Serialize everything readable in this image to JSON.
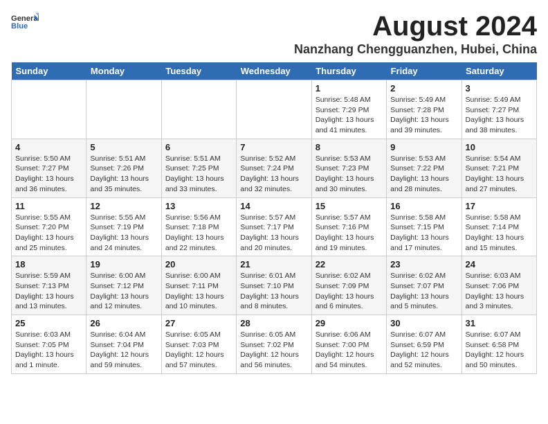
{
  "header": {
    "logo_general": "General",
    "logo_blue": "Blue",
    "title_month": "August 2024",
    "title_location": "Nanzhang Chengguanzhen, Hubei, China"
  },
  "days_of_week": [
    "Sunday",
    "Monday",
    "Tuesday",
    "Wednesday",
    "Thursday",
    "Friday",
    "Saturday"
  ],
  "weeks": [
    [
      {
        "day": "",
        "info": ""
      },
      {
        "day": "",
        "info": ""
      },
      {
        "day": "",
        "info": ""
      },
      {
        "day": "",
        "info": ""
      },
      {
        "day": "1",
        "info": "Sunrise: 5:48 AM\nSunset: 7:29 PM\nDaylight: 13 hours\nand 41 minutes."
      },
      {
        "day": "2",
        "info": "Sunrise: 5:49 AM\nSunset: 7:28 PM\nDaylight: 13 hours\nand 39 minutes."
      },
      {
        "day": "3",
        "info": "Sunrise: 5:49 AM\nSunset: 7:27 PM\nDaylight: 13 hours\nand 38 minutes."
      }
    ],
    [
      {
        "day": "4",
        "info": "Sunrise: 5:50 AM\nSunset: 7:27 PM\nDaylight: 13 hours\nand 36 minutes."
      },
      {
        "day": "5",
        "info": "Sunrise: 5:51 AM\nSunset: 7:26 PM\nDaylight: 13 hours\nand 35 minutes."
      },
      {
        "day": "6",
        "info": "Sunrise: 5:51 AM\nSunset: 7:25 PM\nDaylight: 13 hours\nand 33 minutes."
      },
      {
        "day": "7",
        "info": "Sunrise: 5:52 AM\nSunset: 7:24 PM\nDaylight: 13 hours\nand 32 minutes."
      },
      {
        "day": "8",
        "info": "Sunrise: 5:53 AM\nSunset: 7:23 PM\nDaylight: 13 hours\nand 30 minutes."
      },
      {
        "day": "9",
        "info": "Sunrise: 5:53 AM\nSunset: 7:22 PM\nDaylight: 13 hours\nand 28 minutes."
      },
      {
        "day": "10",
        "info": "Sunrise: 5:54 AM\nSunset: 7:21 PM\nDaylight: 13 hours\nand 27 minutes."
      }
    ],
    [
      {
        "day": "11",
        "info": "Sunrise: 5:55 AM\nSunset: 7:20 PM\nDaylight: 13 hours\nand 25 minutes."
      },
      {
        "day": "12",
        "info": "Sunrise: 5:55 AM\nSunset: 7:19 PM\nDaylight: 13 hours\nand 24 minutes."
      },
      {
        "day": "13",
        "info": "Sunrise: 5:56 AM\nSunset: 7:18 PM\nDaylight: 13 hours\nand 22 minutes."
      },
      {
        "day": "14",
        "info": "Sunrise: 5:57 AM\nSunset: 7:17 PM\nDaylight: 13 hours\nand 20 minutes."
      },
      {
        "day": "15",
        "info": "Sunrise: 5:57 AM\nSunset: 7:16 PM\nDaylight: 13 hours\nand 19 minutes."
      },
      {
        "day": "16",
        "info": "Sunrise: 5:58 AM\nSunset: 7:15 PM\nDaylight: 13 hours\nand 17 minutes."
      },
      {
        "day": "17",
        "info": "Sunrise: 5:58 AM\nSunset: 7:14 PM\nDaylight: 13 hours\nand 15 minutes."
      }
    ],
    [
      {
        "day": "18",
        "info": "Sunrise: 5:59 AM\nSunset: 7:13 PM\nDaylight: 13 hours\nand 13 minutes."
      },
      {
        "day": "19",
        "info": "Sunrise: 6:00 AM\nSunset: 7:12 PM\nDaylight: 13 hours\nand 12 minutes."
      },
      {
        "day": "20",
        "info": "Sunrise: 6:00 AM\nSunset: 7:11 PM\nDaylight: 13 hours\nand 10 minutes."
      },
      {
        "day": "21",
        "info": "Sunrise: 6:01 AM\nSunset: 7:10 PM\nDaylight: 13 hours\nand 8 minutes."
      },
      {
        "day": "22",
        "info": "Sunrise: 6:02 AM\nSunset: 7:09 PM\nDaylight: 13 hours\nand 6 minutes."
      },
      {
        "day": "23",
        "info": "Sunrise: 6:02 AM\nSunset: 7:07 PM\nDaylight: 13 hours\nand 5 minutes."
      },
      {
        "day": "24",
        "info": "Sunrise: 6:03 AM\nSunset: 7:06 PM\nDaylight: 13 hours\nand 3 minutes."
      }
    ],
    [
      {
        "day": "25",
        "info": "Sunrise: 6:03 AM\nSunset: 7:05 PM\nDaylight: 13 hours\nand 1 minute."
      },
      {
        "day": "26",
        "info": "Sunrise: 6:04 AM\nSunset: 7:04 PM\nDaylight: 12 hours\nand 59 minutes."
      },
      {
        "day": "27",
        "info": "Sunrise: 6:05 AM\nSunset: 7:03 PM\nDaylight: 12 hours\nand 57 minutes."
      },
      {
        "day": "28",
        "info": "Sunrise: 6:05 AM\nSunset: 7:02 PM\nDaylight: 12 hours\nand 56 minutes."
      },
      {
        "day": "29",
        "info": "Sunrise: 6:06 AM\nSunset: 7:00 PM\nDaylight: 12 hours\nand 54 minutes."
      },
      {
        "day": "30",
        "info": "Sunrise: 6:07 AM\nSunset: 6:59 PM\nDaylight: 12 hours\nand 52 minutes."
      },
      {
        "day": "31",
        "info": "Sunrise: 6:07 AM\nSunset: 6:58 PM\nDaylight: 12 hours\nand 50 minutes."
      }
    ]
  ]
}
